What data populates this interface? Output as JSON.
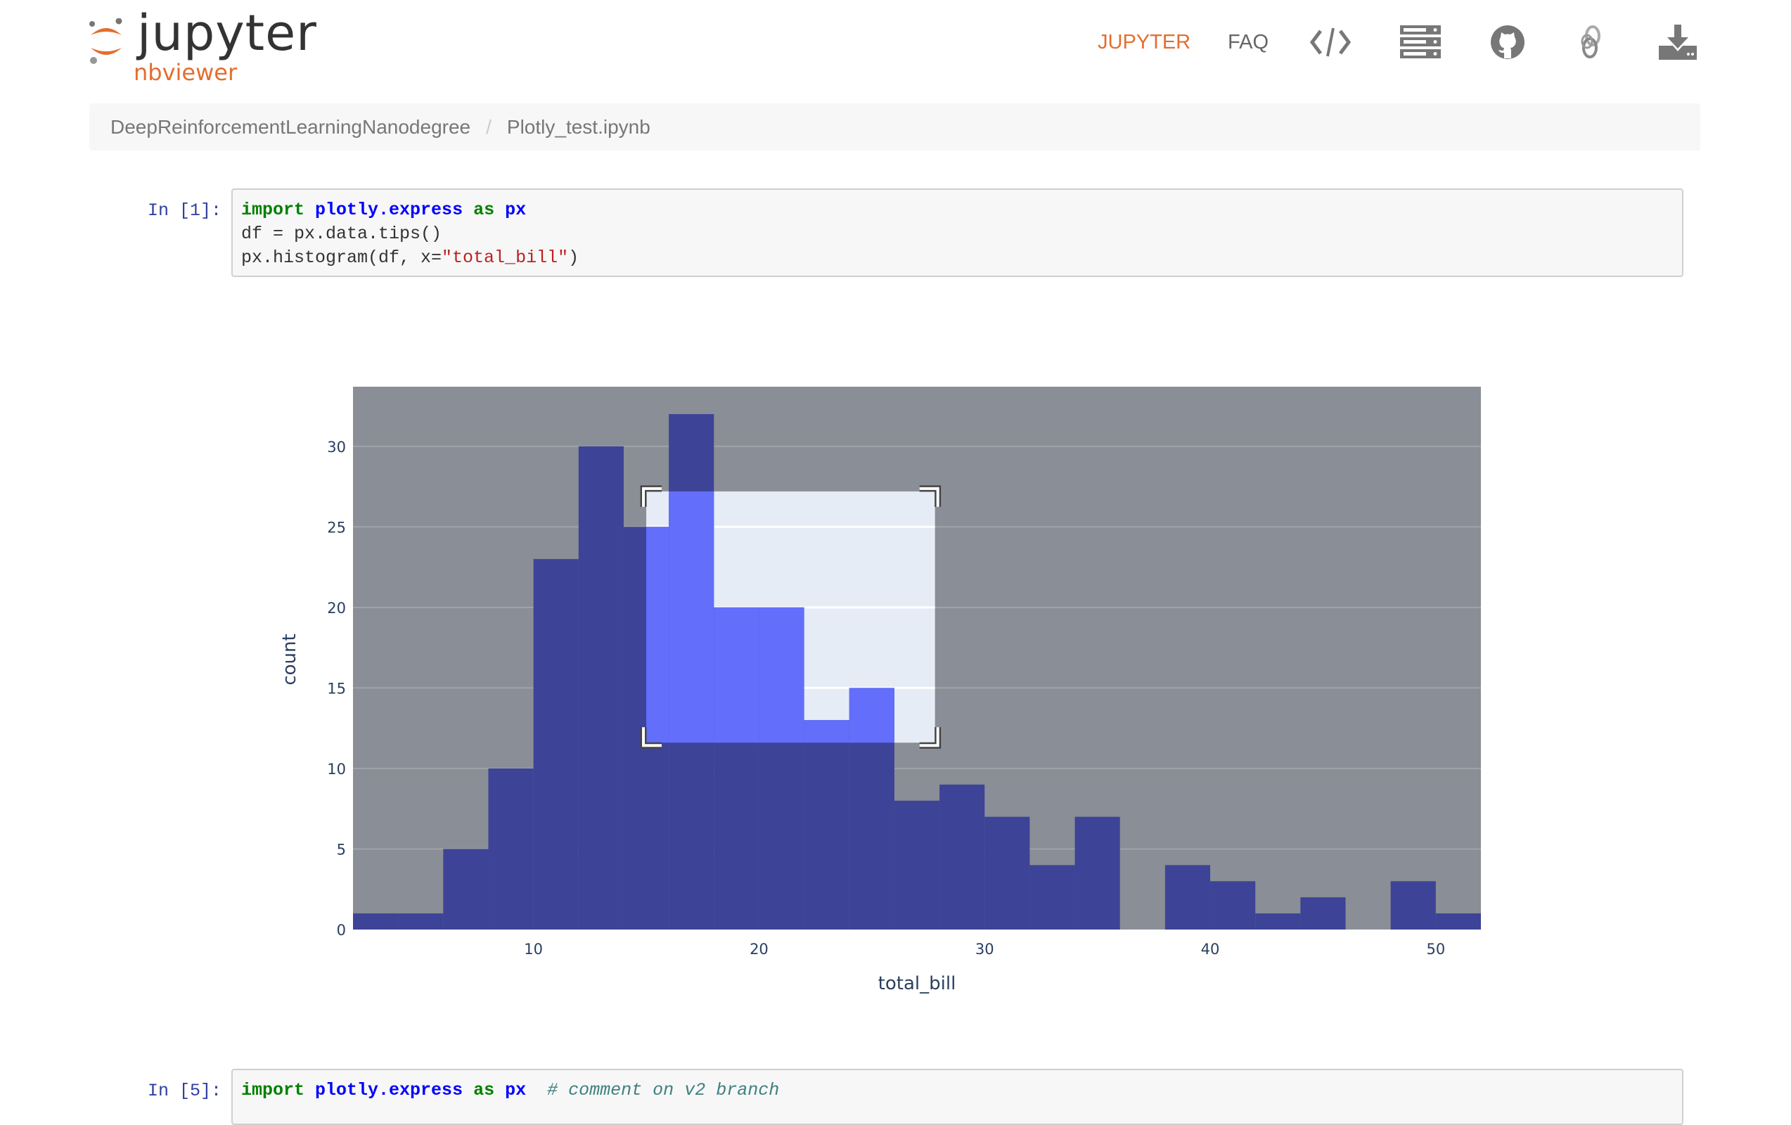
{
  "header": {
    "logo_word": "jupyter",
    "logo_sub": "nbviewer",
    "nav": [
      {
        "label": "JUPYTER",
        "color": "#e46e2e"
      },
      {
        "label": "FAQ",
        "color": "#666666"
      }
    ],
    "icons": [
      "code-icon",
      "server-icon",
      "github-icon",
      "link-icon",
      "download-icon"
    ]
  },
  "breadcrumb": {
    "items": [
      "DeepReinforcementLearningNanodegree",
      "Plotly_test.ipynb"
    ],
    "separator": "/"
  },
  "cells": [
    {
      "prompt": "In [1]:",
      "lines": [
        [
          {
            "t": "import",
            "c": "kw"
          },
          {
            "t": " ",
            "c": ""
          },
          {
            "t": "plotly.express",
            "c": "nn"
          },
          {
            "t": " ",
            "c": ""
          },
          {
            "t": "as",
            "c": "kw"
          },
          {
            "t": " ",
            "c": ""
          },
          {
            "t": "px",
            "c": "nn"
          }
        ],
        [
          {
            "t": "df = px.data.tips()",
            "c": ""
          }
        ],
        [
          {
            "t": "px.histogram(df, x=",
            "c": ""
          },
          {
            "t": "\"total_bill\"",
            "c": "str"
          },
          {
            "t": ")",
            "c": ""
          }
        ]
      ]
    },
    {
      "prompt": "In [5]:",
      "lines": [
        [
          {
            "t": "import",
            "c": "kw"
          },
          {
            "t": " ",
            "c": ""
          },
          {
            "t": "plotly.express",
            "c": "nn"
          },
          {
            "t": " ",
            "c": ""
          },
          {
            "t": "as",
            "c": "kw"
          },
          {
            "t": " ",
            "c": ""
          },
          {
            "t": "px",
            "c": "nn"
          },
          {
            "t": "  ",
            "c": ""
          },
          {
            "t": "# comment on v2 branch",
            "c": "cm"
          }
        ]
      ]
    }
  ],
  "colors": {
    "accent": "#e46e2e",
    "bar": "#3d4396",
    "bar_selected": "#636efa",
    "plot_bg": "#8a8e96",
    "selection": "#e5ecf6",
    "axis_text": "#2a3f5f"
  },
  "chart_data": {
    "type": "bar",
    "subtype": "histogram",
    "title": "",
    "xlabel": "total_bill",
    "ylabel": "count",
    "bin_start": 2,
    "bin_width": 2,
    "values": [
      1,
      1,
      5,
      10,
      23,
      30,
      25,
      32,
      20,
      20,
      13,
      15,
      8,
      9,
      7,
      4,
      7,
      0,
      4,
      3,
      1,
      2,
      0,
      3,
      1
    ],
    "xlim": [
      2,
      52
    ],
    "ylim": [
      0,
      33.7
    ],
    "xticks": [
      10,
      20,
      30,
      40,
      50
    ],
    "yticks": [
      0,
      5,
      10,
      15,
      20,
      25,
      30
    ],
    "grid": true,
    "selection_box": {
      "x": [
        15,
        27.8
      ],
      "y": [
        11.6,
        27.2
      ]
    }
  }
}
